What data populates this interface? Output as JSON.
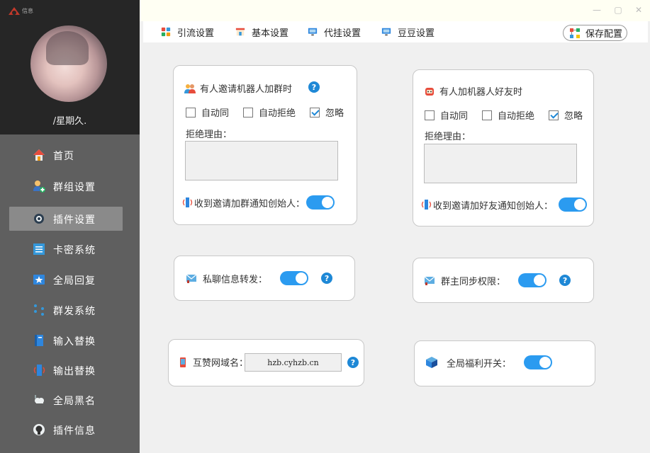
{
  "sidebar": {
    "logo_text": "信息",
    "username": "/星期久.",
    "items": [
      {
        "label": "首页",
        "icon": "home-icon"
      },
      {
        "label": "群组设置",
        "icon": "group-add-icon"
      },
      {
        "label": "插件设置",
        "icon": "plugin-settings-icon",
        "active": true
      },
      {
        "label": "卡密系统",
        "icon": "card-list-icon"
      },
      {
        "label": "全局回复",
        "icon": "star-reply-icon"
      },
      {
        "label": "群发系统",
        "icon": "broadcast-dots-icon"
      },
      {
        "label": "输入替换",
        "icon": "input-replace-icon"
      },
      {
        "label": "输出替换",
        "icon": "output-replace-icon"
      },
      {
        "label": "全局黑名",
        "icon": "cloud-blacklist-icon"
      },
      {
        "label": "插件信息",
        "icon": "github-icon"
      }
    ]
  },
  "toolbar": {
    "tabs": [
      {
        "label": "引流设置",
        "icon": "grid-icon"
      },
      {
        "label": "基本设置",
        "icon": "store-icon"
      },
      {
        "label": "代挂设置",
        "icon": "monitor-icon"
      },
      {
        "label": "豆豆设置",
        "icon": "monitor-icon"
      }
    ],
    "save_label": "保存配置"
  },
  "group_invite": {
    "title": "有人邀请机器人加群时",
    "options": [
      {
        "label": "自动同",
        "checked": false
      },
      {
        "label": "自动拒绝",
        "checked": false
      },
      {
        "label": "忽略",
        "checked": true
      }
    ],
    "reason_label": "拒绝理由：",
    "reason_value": "",
    "notify_label": "收到邀请加群通知创始人：",
    "notify_on": true
  },
  "friend_add": {
    "title": "有人加机器人好友时",
    "options": [
      {
        "label": "自动同",
        "checked": false
      },
      {
        "label": "自动拒绝",
        "checked": false
      },
      {
        "label": "忽略",
        "checked": true
      }
    ],
    "reason_label": "拒绝理由：",
    "reason_value": "",
    "notify_label": "收到邀请加好友通知创始人：",
    "notify_on": true
  },
  "private_forward": {
    "label": "私聊信息转发：",
    "on": true
  },
  "owner_sync": {
    "label": "群主同步权限：",
    "on": true
  },
  "domain": {
    "label": "互赞网域名：",
    "value": "hzb.cyhzb.cn"
  },
  "welfare": {
    "label": "全局福利开关：",
    "on": true
  },
  "help_symbol": "?",
  "window": {
    "minimize": "—",
    "maximize": "▢",
    "close": "✕"
  },
  "colors": {
    "accent": "#2b9bf0",
    "sidebar": "#5f5f5f",
    "sidebar_top": "#262626",
    "active_item": "#8a8a8a"
  }
}
